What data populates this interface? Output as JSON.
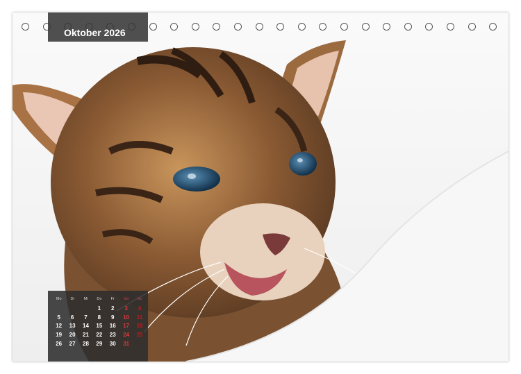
{
  "calendar": {
    "month_title": "Oktober 2026",
    "weekday_headers": [
      "Mo",
      "Di",
      "Mi",
      "Do",
      "Fr",
      "Sa",
      "So"
    ],
    "weeks": [
      [
        "",
        "",
        "",
        "1",
        "2",
        "3",
        "4"
      ],
      [
        "5",
        "6",
        "7",
        "8",
        "9",
        "10",
        "11"
      ],
      [
        "12",
        "13",
        "14",
        "15",
        "16",
        "17",
        "18"
      ],
      [
        "19",
        "20",
        "21",
        "22",
        "23",
        "24",
        "25"
      ],
      [
        "26",
        "27",
        "28",
        "29",
        "30",
        "31",
        ""
      ]
    ]
  },
  "colors": {
    "overlay": "#373737",
    "weekend": "#d63a3a",
    "text": "#ffffff"
  },
  "photo": {
    "subject": "kitten"
  }
}
